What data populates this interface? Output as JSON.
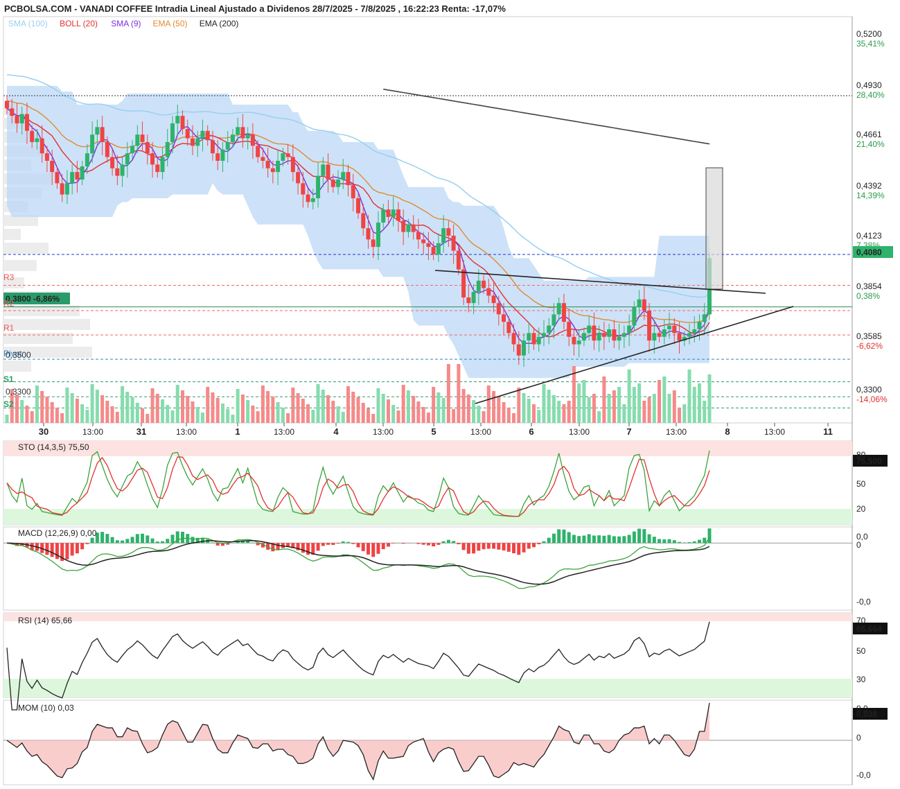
{
  "title": "PCBOLSA.COM - VANADI COFFEE Intradia Lineal Ajustado a Dividenos 28/7/2025 - 7/8/2025 , 16:22:23 Renta: -17,07%",
  "legend": [
    {
      "label": "SMA (100)",
      "color": "#9ad0f0"
    },
    {
      "label": "BOLL (20)",
      "color": "#e03030"
    },
    {
      "label": "SMA (9)",
      "color": "#7a30e0"
    },
    {
      "label": "EMA (50)",
      "color": "#e08a30"
    },
    {
      "label": "EMA (200)",
      "color": "#222222"
    }
  ],
  "price_axis": [
    {
      "value": "0,5200",
      "pct": "35,41%",
      "pct_color": "#2a9a4a"
    },
    {
      "value": "0,4930",
      "pct": "28,40%",
      "pct_color": "#2a9a4a"
    },
    {
      "value": "0,4661",
      "pct": "21,40%",
      "pct_color": "#2a9a4a"
    },
    {
      "value": "0,4392",
      "pct": "14,39%",
      "pct_color": "#2a9a4a"
    },
    {
      "value": "0,4123",
      "pct": "7,38%",
      "pct_color": "#2a9a4a"
    },
    {
      "value": "0,3854",
      "pct": "0,38%",
      "pct_color": "#2a9a4a"
    },
    {
      "value": "0,3585",
      "pct": "-6,62%",
      "pct_color": "#e03030"
    },
    {
      "value": "0,3300",
      "pct": "-14,06%",
      "pct_color": "#e03030"
    }
  ],
  "current_price": "0,4080",
  "ref_price": "0,3800",
  "ref_pct": "-6,86%",
  "left_marks": {
    "pivot": "Pivot",
    "pivot_value": "0,3500",
    "s1": "S1",
    "s2": "S2",
    "s_value": "0,3300",
    "r1": "R1",
    "r2": "R2",
    "r3": "R3"
  },
  "x_axis": [
    {
      "label": "30",
      "bold": true
    },
    {
      "label": "13:00",
      "bold": false
    },
    {
      "label": "31",
      "bold": true
    },
    {
      "label": "13:00",
      "bold": false
    },
    {
      "label": "1",
      "bold": true
    },
    {
      "label": "13:00",
      "bold": false
    },
    {
      "label": "4",
      "bold": true
    },
    {
      "label": "13:00",
      "bold": false
    },
    {
      "label": "5",
      "bold": true
    },
    {
      "label": "13:00",
      "bold": false
    },
    {
      "label": "6",
      "bold": true
    },
    {
      "label": "13:00",
      "bold": false
    },
    {
      "label": "7",
      "bold": true
    },
    {
      "label": "13:00",
      "bold": false
    },
    {
      "label": "8",
      "bold": true
    },
    {
      "label": "13:00",
      "bold": false
    },
    {
      "label": "11",
      "bold": true
    }
  ],
  "panels": {
    "sto": {
      "label": "STO (14,3,5)",
      "value": "75,50",
      "badge": "75,500",
      "ticks": [
        "80",
        "50",
        "20"
      ]
    },
    "macd": {
      "label": "MACD (12,26,9)",
      "value": "0,00",
      "ticks": [
        "0,0",
        "0",
        "-0,0"
      ]
    },
    "rsi": {
      "label": "RSI (14)",
      "value": "65,66",
      "badge": "65,664",
      "ticks": [
        "70",
        "50",
        "30"
      ]
    },
    "mom": {
      "label": "MOM (10)",
      "value": "0,03",
      "badge": "0,038",
      "ticks": [
        "0,0",
        "0",
        "-0,0"
      ]
    }
  },
  "colors": {
    "up": "#2db36b",
    "down": "#ef4444",
    "boll_fill": "#bcd8f5"
  },
  "chart_data": {
    "type": "candlestick",
    "ylim": [
      0.318,
      0.535
    ],
    "closes": [
      0.486,
      0.482,
      0.478,
      0.483,
      0.474,
      0.468,
      0.47,
      0.462,
      0.458,
      0.452,
      0.446,
      0.44,
      0.446,
      0.452,
      0.448,
      0.455,
      0.462,
      0.472,
      0.476,
      0.468,
      0.46,
      0.454,
      0.45,
      0.456,
      0.462,
      0.466,
      0.472,
      0.468,
      0.462,
      0.456,
      0.452,
      0.46,
      0.468,
      0.478,
      0.482,
      0.475,
      0.47,
      0.466,
      0.47,
      0.474,
      0.469,
      0.462,
      0.458,
      0.464,
      0.468,
      0.472,
      0.476,
      0.47,
      0.472,
      0.466,
      0.46,
      0.458,
      0.454,
      0.452,
      0.458,
      0.462,
      0.46,
      0.452,
      0.446,
      0.44,
      0.436,
      0.438,
      0.45,
      0.456,
      0.448,
      0.444,
      0.448,
      0.452,
      0.445,
      0.438,
      0.43,
      0.422,
      0.416,
      0.412,
      0.425,
      0.432,
      0.428,
      0.432,
      0.426,
      0.42,
      0.424,
      0.42,
      0.416,
      0.414,
      0.412,
      0.408,
      0.414,
      0.422,
      0.418,
      0.41,
      0.4,
      0.385,
      0.382,
      0.388,
      0.394,
      0.39,
      0.386,
      0.382,
      0.376,
      0.372,
      0.366,
      0.36,
      0.354,
      0.362,
      0.366,
      0.36,
      0.364,
      0.366,
      0.37,
      0.376,
      0.382,
      0.372,
      0.364,
      0.36,
      0.362,
      0.366,
      0.37,
      0.362,
      0.366,
      0.364,
      0.368,
      0.362,
      0.364,
      0.366,
      0.37,
      0.38,
      0.384,
      0.378,
      0.362,
      0.366,
      0.364,
      0.368,
      0.37,
      0.366,
      0.362,
      0.364,
      0.366,
      0.368,
      0.372,
      0.376,
      0.406
    ],
    "volume_note": "volume bars shown below price"
  }
}
